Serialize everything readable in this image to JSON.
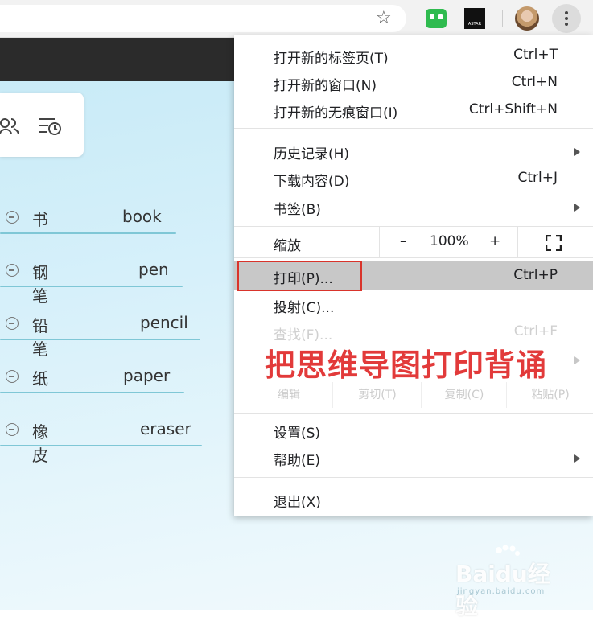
{
  "toolbar": {
    "star_icon": "star-icon",
    "ext_astar_text": "ASTAR",
    "menu_icon": "kebab-menu-icon"
  },
  "mindmap": {
    "nodes": [
      {
        "cn": "书",
        "en": "book"
      },
      {
        "cn": "钢笔",
        "en": "pen"
      },
      {
        "cn": "铅笔",
        "en": "pencil"
      },
      {
        "cn": "纸",
        "en": "paper"
      },
      {
        "cn": "橡皮",
        "en": "eraser"
      }
    ]
  },
  "menu": {
    "new_tab": {
      "label": "打开新的标签页(T)",
      "shortcut": "Ctrl+T"
    },
    "new_window": {
      "label": "打开新的窗口(N)",
      "shortcut": "Ctrl+N"
    },
    "incognito": {
      "label": "打开新的无痕窗口(I)",
      "shortcut": "Ctrl+Shift+N"
    },
    "history": {
      "label": "历史记录(H)"
    },
    "downloads": {
      "label": "下载内容(D)",
      "shortcut": "Ctrl+J"
    },
    "bookmarks": {
      "label": "书签(B)"
    },
    "zoom": {
      "label": "缩放",
      "minus": "–",
      "value": "100%",
      "plus": "+"
    },
    "print": {
      "label": "打印(P)...",
      "shortcut": "Ctrl+P"
    },
    "cast": {
      "label": "投射(C)..."
    },
    "find": {
      "label": "查找(F)...",
      "shortcut": "Ctrl+F"
    },
    "edit": {
      "label": "编辑",
      "cut": "剪切(T)",
      "copy": "复制(C)",
      "paste": "粘贴(P)"
    },
    "settings": {
      "label": "设置(S)"
    },
    "help": {
      "label": "帮助(E)"
    },
    "exit": {
      "label": "退出(X)"
    }
  },
  "overlay_caption": "把思维导图打印背诵",
  "watermark": {
    "logo": "Baidu经验",
    "sub": "jingyan.baidu.com"
  },
  "colors": {
    "highlight": "#c8c8c8",
    "callout": "#d9342b",
    "caption": "#e23a3a"
  }
}
